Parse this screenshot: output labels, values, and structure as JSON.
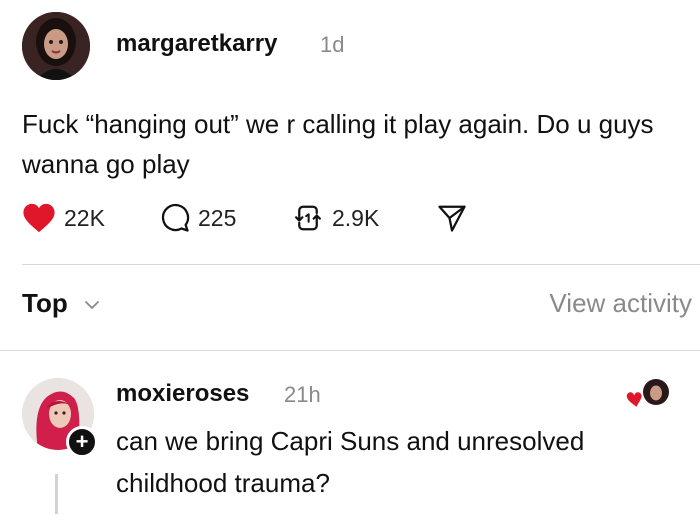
{
  "post": {
    "author": "margaretkarry",
    "time": "1d",
    "text": "Fuck “hanging out” we r calling it play again. Do u guys wanna go play",
    "likes": "22K",
    "comments": "225",
    "reposts": "2.9K",
    "liked": true
  },
  "sort": {
    "label": "Top",
    "view_activity": "View activity"
  },
  "reply": {
    "author": "moxieroses",
    "time": "21h",
    "text": "can we bring Capri Suns and unresolved childhood trauma?",
    "follow_badge": "+"
  },
  "colors": {
    "like_red": "#e0172b",
    "muted_text": "#8a8a8a",
    "divider": "#d8d8d8"
  },
  "icons": {
    "like": "heart-icon",
    "comment": "comment-bubble-icon",
    "repost": "repost-arrows-icon",
    "share": "send-paper-plane-icon",
    "sort": "chevron-down-icon"
  }
}
